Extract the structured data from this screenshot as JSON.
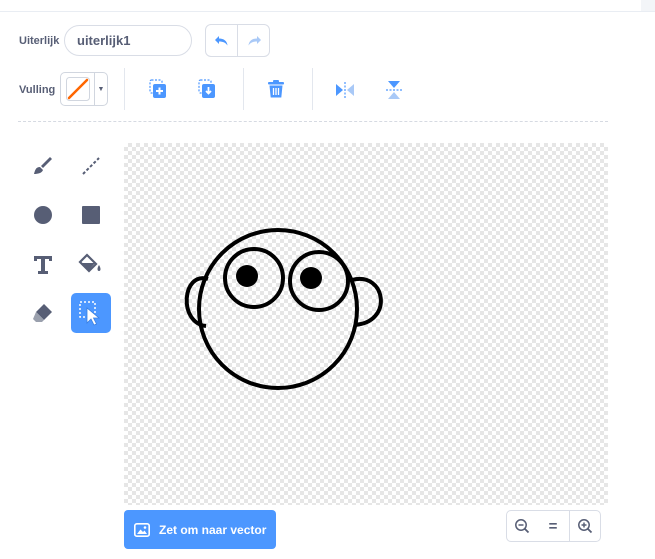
{
  "costume": {
    "label": "Uiterlijk",
    "name_value": "uiterlijk1"
  },
  "fill": {
    "label": "Vulling",
    "color": "#ff6600"
  },
  "colors": {
    "accent": "#4c97ff",
    "text": "#575e75",
    "border": "#d9dde6"
  },
  "toolbar": {
    "icons": [
      "undo-icon",
      "redo-icon",
      "copy-icon",
      "paste-icon",
      "delete-icon",
      "flip-horizontal-icon",
      "flip-vertical-icon"
    ]
  },
  "tools": [
    "brush-icon",
    "line-icon",
    "circle-icon",
    "rectangle-icon",
    "text-icon",
    "fill-bucket-icon",
    "eraser-icon",
    "select-icon"
  ],
  "active_tool": "select",
  "convert": {
    "label": "Zet om naar vector"
  },
  "zoom": {
    "reset_label": "="
  }
}
